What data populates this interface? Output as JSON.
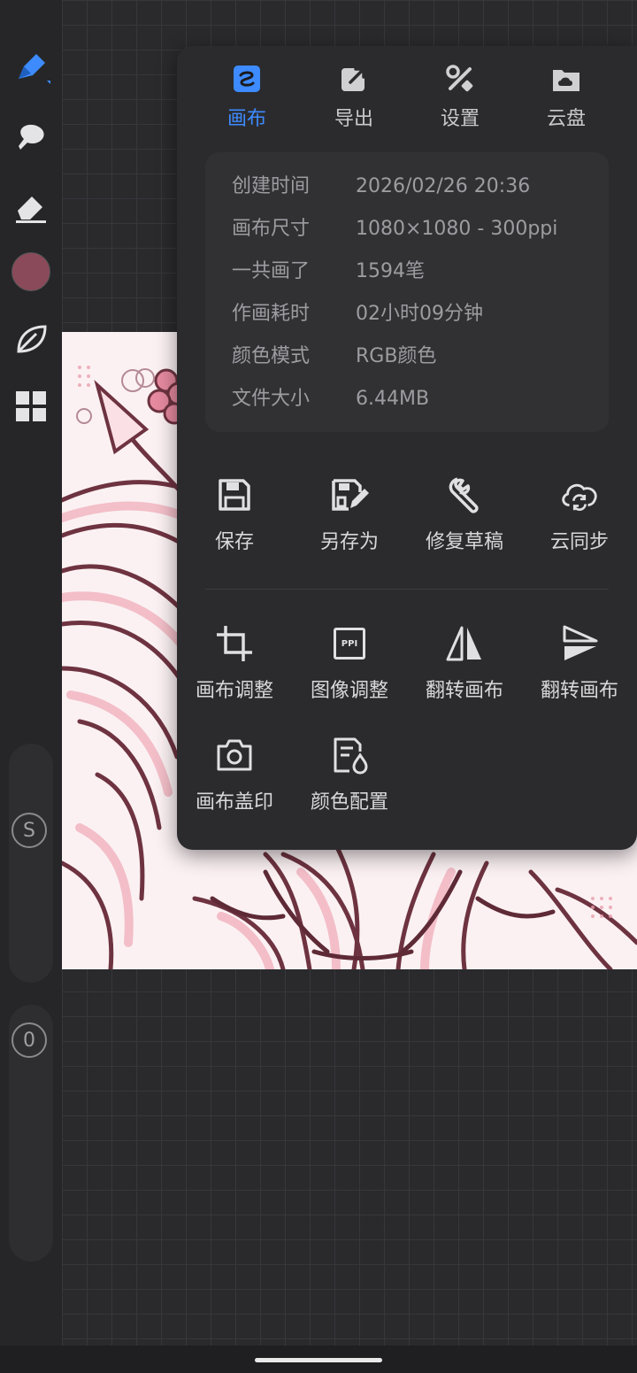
{
  "tabs": [
    {
      "label": "画布",
      "icon": "canvas-icon",
      "active": true
    },
    {
      "label": "导出",
      "icon": "export-icon",
      "active": false
    },
    {
      "label": "设置",
      "icon": "settings-tools-icon",
      "active": false
    },
    {
      "label": "云盘",
      "icon": "cloud-drive-icon",
      "active": false
    }
  ],
  "info": [
    {
      "key": "创建时间",
      "value": "2026/02/26 20:36"
    },
    {
      "key": "画布尺寸",
      "value": "1080×1080 - 300ppi"
    },
    {
      "key": "一共画了",
      "value": "1594笔"
    },
    {
      "key": "作画耗时",
      "value": "02小时09分钟"
    },
    {
      "key": "颜色模式",
      "value": "RGB颜色"
    },
    {
      "key": "文件大小",
      "value": "6.44MB"
    }
  ],
  "actions_row1": [
    {
      "label": "保存",
      "icon": "save-icon"
    },
    {
      "label": "另存为",
      "icon": "save-as-icon"
    },
    {
      "label": "修复草稿",
      "icon": "wrench-icon"
    },
    {
      "label": "云同步",
      "icon": "cloud-sync-icon"
    }
  ],
  "actions_row2": [
    {
      "label": "画布调整",
      "icon": "crop-icon"
    },
    {
      "label": "图像调整",
      "icon": "ppi-icon",
      "icon_text": "PPI"
    },
    {
      "label": "翻转画布",
      "icon": "flip-horizontal-icon"
    },
    {
      "label": "翻转画布",
      "icon": "flip-vertical-icon"
    }
  ],
  "actions_row3": [
    {
      "label": "画布盖印",
      "icon": "camera-icon"
    },
    {
      "label": "颜色配置",
      "icon": "color-profile-icon"
    }
  ],
  "toolbar": {
    "current_color": "#8a4a5a",
    "size_slider_label": "S",
    "opacity_slider_label": "0"
  },
  "colors": {
    "accent": "#3d8bff",
    "panel": "#2b2b2e",
    "artwork_line": "#6e3340",
    "artwork_fill": "#f3c4cc"
  }
}
